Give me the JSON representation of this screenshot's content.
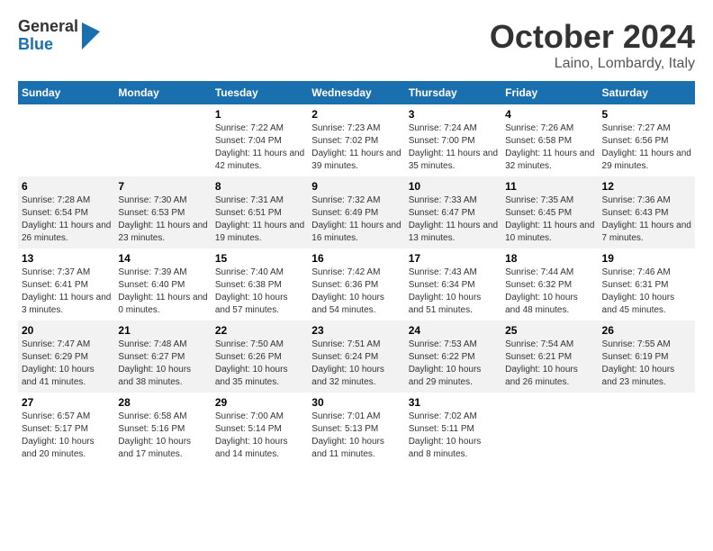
{
  "header": {
    "logo": {
      "general": "General",
      "blue": "Blue"
    },
    "title": "October 2024",
    "subtitle": "Laino, Lombardy, Italy"
  },
  "days_of_week": [
    "Sunday",
    "Monday",
    "Tuesday",
    "Wednesday",
    "Thursday",
    "Friday",
    "Saturday"
  ],
  "weeks": [
    [
      {
        "day": "",
        "sunrise": "",
        "sunset": "",
        "daylight": ""
      },
      {
        "day": "",
        "sunrise": "",
        "sunset": "",
        "daylight": ""
      },
      {
        "day": "1",
        "sunrise": "Sunrise: 7:22 AM",
        "sunset": "Sunset: 7:04 PM",
        "daylight": "Daylight: 11 hours and 42 minutes."
      },
      {
        "day": "2",
        "sunrise": "Sunrise: 7:23 AM",
        "sunset": "Sunset: 7:02 PM",
        "daylight": "Daylight: 11 hours and 39 minutes."
      },
      {
        "day": "3",
        "sunrise": "Sunrise: 7:24 AM",
        "sunset": "Sunset: 7:00 PM",
        "daylight": "Daylight: 11 hours and 35 minutes."
      },
      {
        "day": "4",
        "sunrise": "Sunrise: 7:26 AM",
        "sunset": "Sunset: 6:58 PM",
        "daylight": "Daylight: 11 hours and 32 minutes."
      },
      {
        "day": "5",
        "sunrise": "Sunrise: 7:27 AM",
        "sunset": "Sunset: 6:56 PM",
        "daylight": "Daylight: 11 hours and 29 minutes."
      }
    ],
    [
      {
        "day": "6",
        "sunrise": "Sunrise: 7:28 AM",
        "sunset": "Sunset: 6:54 PM",
        "daylight": "Daylight: 11 hours and 26 minutes."
      },
      {
        "day": "7",
        "sunrise": "Sunrise: 7:30 AM",
        "sunset": "Sunset: 6:53 PM",
        "daylight": "Daylight: 11 hours and 23 minutes."
      },
      {
        "day": "8",
        "sunrise": "Sunrise: 7:31 AM",
        "sunset": "Sunset: 6:51 PM",
        "daylight": "Daylight: 11 hours and 19 minutes."
      },
      {
        "day": "9",
        "sunrise": "Sunrise: 7:32 AM",
        "sunset": "Sunset: 6:49 PM",
        "daylight": "Daylight: 11 hours and 16 minutes."
      },
      {
        "day": "10",
        "sunrise": "Sunrise: 7:33 AM",
        "sunset": "Sunset: 6:47 PM",
        "daylight": "Daylight: 11 hours and 13 minutes."
      },
      {
        "day": "11",
        "sunrise": "Sunrise: 7:35 AM",
        "sunset": "Sunset: 6:45 PM",
        "daylight": "Daylight: 11 hours and 10 minutes."
      },
      {
        "day": "12",
        "sunrise": "Sunrise: 7:36 AM",
        "sunset": "Sunset: 6:43 PM",
        "daylight": "Daylight: 11 hours and 7 minutes."
      }
    ],
    [
      {
        "day": "13",
        "sunrise": "Sunrise: 7:37 AM",
        "sunset": "Sunset: 6:41 PM",
        "daylight": "Daylight: 11 hours and 3 minutes."
      },
      {
        "day": "14",
        "sunrise": "Sunrise: 7:39 AM",
        "sunset": "Sunset: 6:40 PM",
        "daylight": "Daylight: 11 hours and 0 minutes."
      },
      {
        "day": "15",
        "sunrise": "Sunrise: 7:40 AM",
        "sunset": "Sunset: 6:38 PM",
        "daylight": "Daylight: 10 hours and 57 minutes."
      },
      {
        "day": "16",
        "sunrise": "Sunrise: 7:42 AM",
        "sunset": "Sunset: 6:36 PM",
        "daylight": "Daylight: 10 hours and 54 minutes."
      },
      {
        "day": "17",
        "sunrise": "Sunrise: 7:43 AM",
        "sunset": "Sunset: 6:34 PM",
        "daylight": "Daylight: 10 hours and 51 minutes."
      },
      {
        "day": "18",
        "sunrise": "Sunrise: 7:44 AM",
        "sunset": "Sunset: 6:32 PM",
        "daylight": "Daylight: 10 hours and 48 minutes."
      },
      {
        "day": "19",
        "sunrise": "Sunrise: 7:46 AM",
        "sunset": "Sunset: 6:31 PM",
        "daylight": "Daylight: 10 hours and 45 minutes."
      }
    ],
    [
      {
        "day": "20",
        "sunrise": "Sunrise: 7:47 AM",
        "sunset": "Sunset: 6:29 PM",
        "daylight": "Daylight: 10 hours and 41 minutes."
      },
      {
        "day": "21",
        "sunrise": "Sunrise: 7:48 AM",
        "sunset": "Sunset: 6:27 PM",
        "daylight": "Daylight: 10 hours and 38 minutes."
      },
      {
        "day": "22",
        "sunrise": "Sunrise: 7:50 AM",
        "sunset": "Sunset: 6:26 PM",
        "daylight": "Daylight: 10 hours and 35 minutes."
      },
      {
        "day": "23",
        "sunrise": "Sunrise: 7:51 AM",
        "sunset": "Sunset: 6:24 PM",
        "daylight": "Daylight: 10 hours and 32 minutes."
      },
      {
        "day": "24",
        "sunrise": "Sunrise: 7:53 AM",
        "sunset": "Sunset: 6:22 PM",
        "daylight": "Daylight: 10 hours and 29 minutes."
      },
      {
        "day": "25",
        "sunrise": "Sunrise: 7:54 AM",
        "sunset": "Sunset: 6:21 PM",
        "daylight": "Daylight: 10 hours and 26 minutes."
      },
      {
        "day": "26",
        "sunrise": "Sunrise: 7:55 AM",
        "sunset": "Sunset: 6:19 PM",
        "daylight": "Daylight: 10 hours and 23 minutes."
      }
    ],
    [
      {
        "day": "27",
        "sunrise": "Sunrise: 6:57 AM",
        "sunset": "Sunset: 5:17 PM",
        "daylight": "Daylight: 10 hours and 20 minutes."
      },
      {
        "day": "28",
        "sunrise": "Sunrise: 6:58 AM",
        "sunset": "Sunset: 5:16 PM",
        "daylight": "Daylight: 10 hours and 17 minutes."
      },
      {
        "day": "29",
        "sunrise": "Sunrise: 7:00 AM",
        "sunset": "Sunset: 5:14 PM",
        "daylight": "Daylight: 10 hours and 14 minutes."
      },
      {
        "day": "30",
        "sunrise": "Sunrise: 7:01 AM",
        "sunset": "Sunset: 5:13 PM",
        "daylight": "Daylight: 10 hours and 11 minutes."
      },
      {
        "day": "31",
        "sunrise": "Sunrise: 7:02 AM",
        "sunset": "Sunset: 5:11 PM",
        "daylight": "Daylight: 10 hours and 8 minutes."
      },
      {
        "day": "",
        "sunrise": "",
        "sunset": "",
        "daylight": ""
      },
      {
        "day": "",
        "sunrise": "",
        "sunset": "",
        "daylight": ""
      }
    ]
  ]
}
